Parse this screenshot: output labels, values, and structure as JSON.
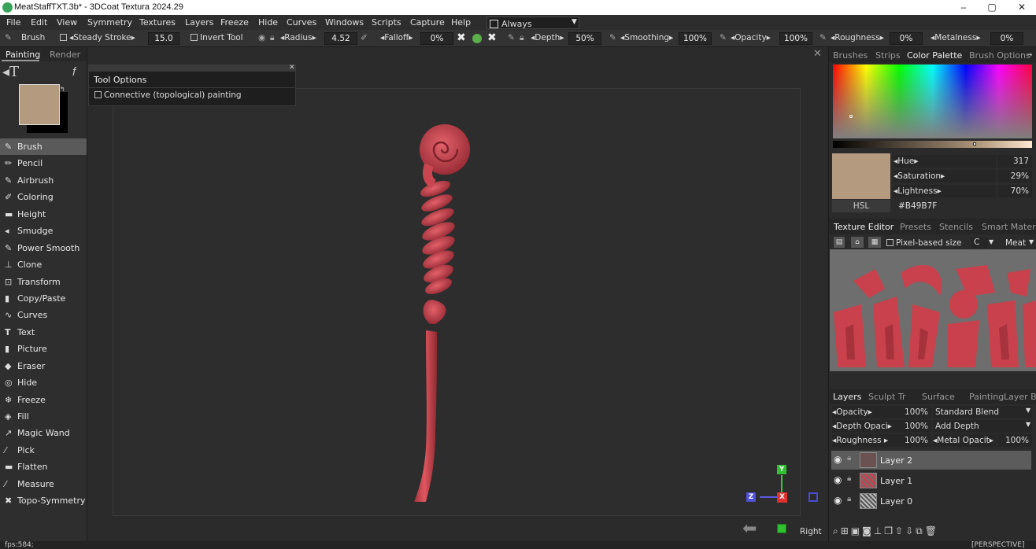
{
  "titlebar": {
    "title": "MeatStaffTXT.3b* - 3DCoat Textura 2024.29",
    "minimize": "–",
    "restore": "▢",
    "close": "✕"
  },
  "menu": [
    "File",
    "Edit",
    "View",
    "Symmetry",
    "Textures",
    "Layers",
    "Freeze",
    "Hide",
    "Curves",
    "Windows",
    "Scripts",
    "Capture",
    "Help"
  ],
  "menu_dropdown": {
    "value": "Always"
  },
  "toolbar": {
    "tool": "Brush",
    "steady_stroke": "Steady Stroke",
    "steady_value": "15.0",
    "invert_tool": "Invert Tool",
    "radius": "Radius",
    "radius_value": "4.52",
    "falloff": "Falloff",
    "falloff_value": "0%",
    "depth": "Depth",
    "depth_value": "50%",
    "smoothing": "Smoothing",
    "smoothing_value": "100%",
    "opacity": "Opacity",
    "opacity_value": "100%",
    "roughness": "Roughness",
    "roughness_value": "0%",
    "metalness": "Metalness",
    "metalness_value": "0%"
  },
  "left": {
    "tabs": [
      "Painting",
      "Render"
    ],
    "tools": [
      "Brush",
      "Pencil",
      "Airbrush",
      "Coloring",
      "Height",
      "Smudge",
      "Power Smooth",
      "Clone",
      "Transform",
      "Copy/Paste",
      "Curves",
      "Text",
      "Picture",
      "Eraser",
      "Hide",
      "Freeze",
      "Fill",
      "Magic Wand",
      "Pick",
      "Flatten",
      "Measure",
      "Topo-Symmetry"
    ],
    "tool_icons": [
      "brush-icon",
      "pencil-icon",
      "airbrush-icon",
      "coloring-icon",
      "height-icon",
      "smudge-icon",
      "power-smooth-icon",
      "clone-icon",
      "transform-icon",
      "copy-paste-icon",
      "curves-icon",
      "text-icon",
      "picture-icon",
      "eraser-icon",
      "hide-icon",
      "freeze-icon",
      "fill-icon",
      "magic-wand-icon",
      "pick-icon",
      "flatten-icon",
      "measure-icon",
      "topo-symmetry-icon"
    ],
    "primary_color": "#B49B7F"
  },
  "tool_options": {
    "title": "Tool Options",
    "connective": "Connective (topological) painting"
  },
  "viewport": {
    "view_label": "Right",
    "perspective": "[PERSPECTIVE]",
    "axis_y": "Y",
    "axis_x": "X",
    "axis_z": "Z"
  },
  "right": {
    "top_tabs": [
      "Brushes",
      "Strips",
      "Color Palette",
      "Brush Options"
    ],
    "hue_label": "Hue",
    "hue_value": "317",
    "sat_label": "Saturation",
    "sat_value": "29%",
    "light_label": "Lightness",
    "light_value": "70%",
    "mode": "HSL",
    "hex": "#B49B7F",
    "mid_tabs": [
      "Texture Editor",
      "Presets",
      "Stencils",
      "Smart Materi"
    ],
    "pixel_based": "Pixel-based size",
    "channel": "C",
    "material": "Meat",
    "layer_tabs": [
      "Layers",
      "Sculpt Tr",
      "Surface",
      "Painting",
      "Layer Ble"
    ],
    "opacity_label": "Opacity",
    "opacity_value": "100%",
    "blend": "Standard Blend",
    "depth_op_label": "Depth Opaci",
    "depth_op_value": "100%",
    "depth_mode": "Add Depth",
    "rough_label": "Roughness",
    "rough_value": "100%",
    "metal_label": "Metal Opacit",
    "metal_value": "100%",
    "layers": [
      "Layer 2",
      "Layer 1",
      "Layer 0"
    ]
  },
  "status": {
    "fps": "fps:584;"
  }
}
